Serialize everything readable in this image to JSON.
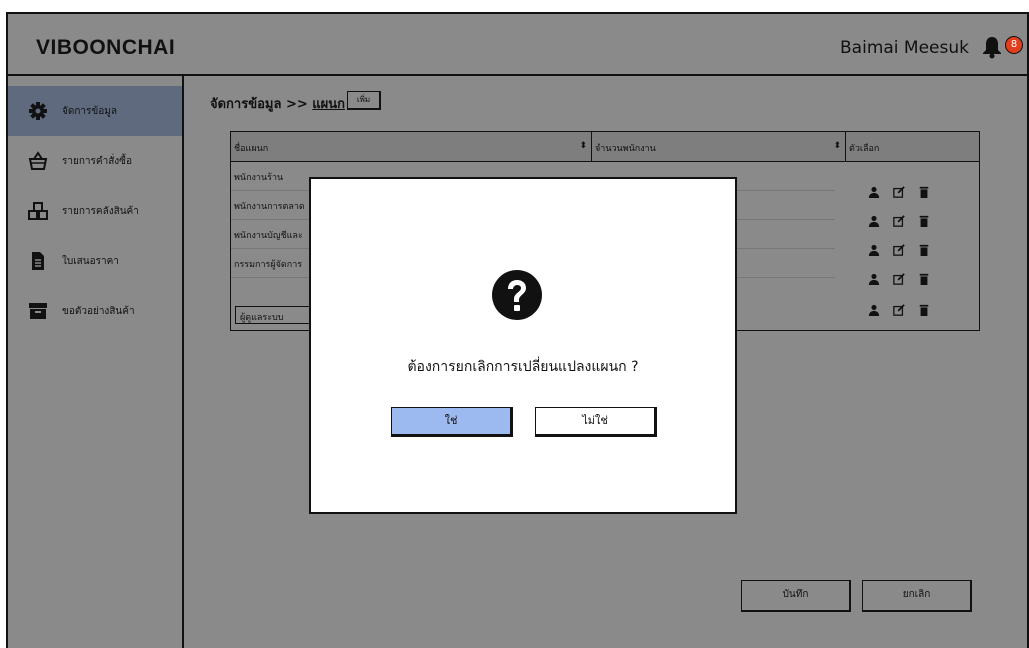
{
  "app": {
    "brand": "VIBOONCHAI",
    "user_name": "Baimai Meesuk",
    "notification_count": "8"
  },
  "sidebar": {
    "items": [
      {
        "label": "จัดการข้อมูล",
        "icon": "gear-icon",
        "active": true
      },
      {
        "label": "รายการคำสั่งซื้อ",
        "icon": "basket-icon",
        "active": false
      },
      {
        "label": "รายการคลังสินค้า",
        "icon": "cubes-icon",
        "active": false
      },
      {
        "label": "ใบเสนอราคา",
        "icon": "document-icon",
        "active": false
      },
      {
        "label": "ขอตัวอย่างสินค้า",
        "icon": "archive-icon",
        "active": false
      }
    ]
  },
  "breadcrumb": {
    "prefix": "จัดการข้อมูล >> ",
    "current": "แผนก",
    "add_label": "เพิ่ม"
  },
  "table": {
    "columns": [
      "ชื่อแผนก",
      "จำนวนพนักงาน",
      "ตัวเลือก"
    ],
    "rows": [
      {
        "name": "พนักงานร้าน"
      },
      {
        "name": "พนักงานการตลาด"
      },
      {
        "name": "พนักงานบัญชีและ"
      },
      {
        "name": "กรรมการผู้จัดการ"
      }
    ],
    "editing_value": "ผู้ดูแลระบบ",
    "action_icons": [
      "user-icon",
      "edit-icon",
      "trash-icon"
    ]
  },
  "footer": {
    "save_label": "บันทึก",
    "cancel_label": "ยกเลิก"
  },
  "dialog": {
    "question": "ต้องการยกเลิกการเปลี่ยนแปลงแผนก ?",
    "yes_label": "ใช่",
    "no_label": "ไม่ใช่",
    "icon": "question-icon"
  },
  "colors": {
    "active_sidebar": "#5f6a7e",
    "yes_button": "#9dbaf0",
    "badge": "#e23d1c",
    "overlay": "#8a8a8a"
  }
}
